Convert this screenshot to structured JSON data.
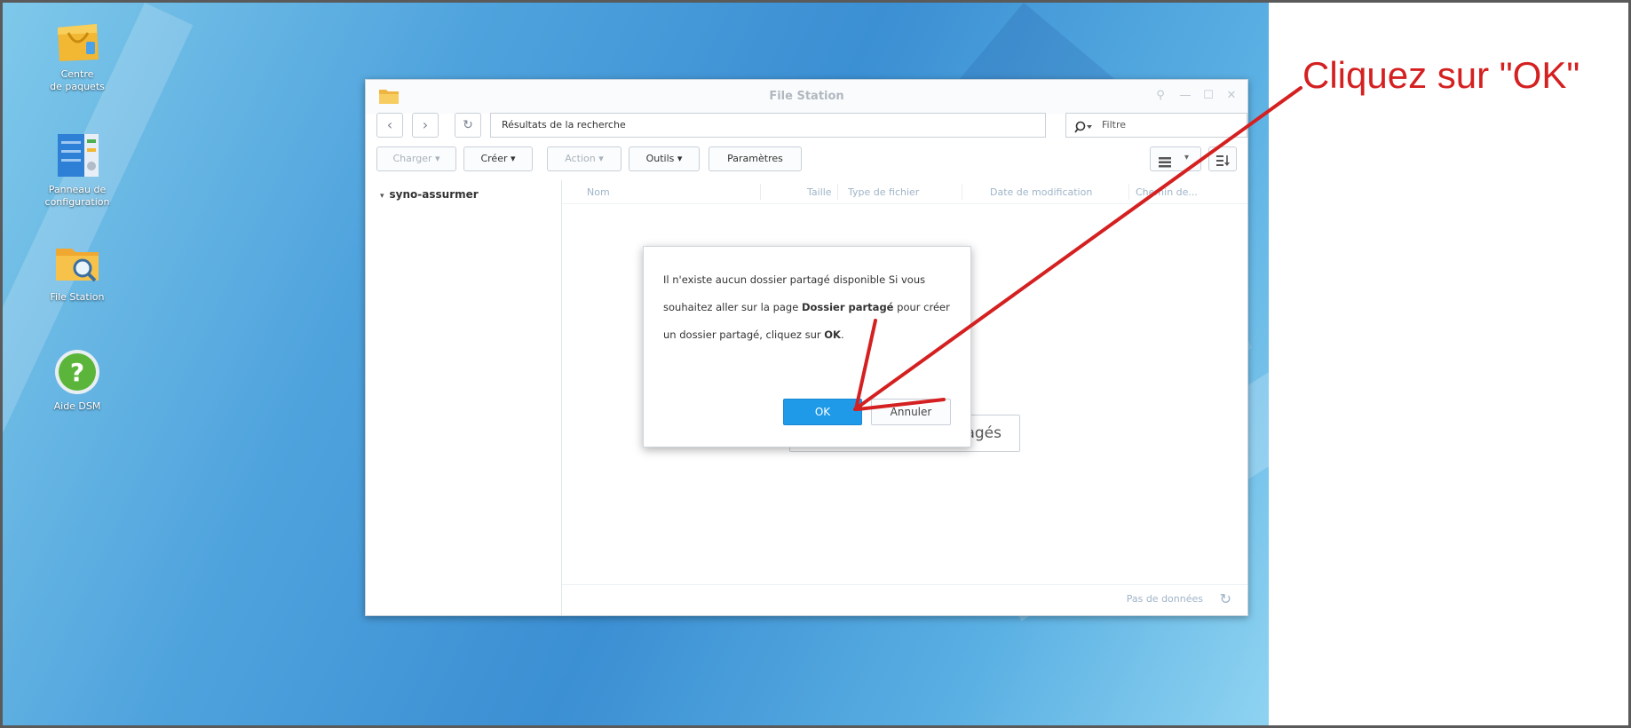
{
  "desktop": {
    "icons": [
      {
        "label_line1": "Centre",
        "label_line2": "de paquets",
        "icon": "package-center-icon"
      },
      {
        "label_line1": "Panneau de",
        "label_line2": "configuration",
        "icon": "control-panel-icon"
      },
      {
        "label_line1": "File Station",
        "label_line2": "",
        "icon": "file-station-icon"
      },
      {
        "label_line1": "Aide DSM",
        "label_line2": "",
        "icon": "help-icon"
      }
    ]
  },
  "window": {
    "title": "File Station",
    "path": "Résultats de la recherche",
    "filter_placeholder": "Filtre",
    "toolbar": {
      "charger": "Charger ▾",
      "creer": "Créer ▾",
      "action": "Action ▾",
      "outils": "Outils ▾",
      "parametres": "Paramètres"
    },
    "tree": {
      "root": "syno-assurmer"
    },
    "columns": [
      "Nom",
      "Taille",
      "Type de fichier",
      "Date de modification",
      "Chemin de..."
    ],
    "background_button_text": "agés",
    "footer": {
      "status": "Pas de données"
    }
  },
  "dialog": {
    "message_part1": "Il n'existe aucun dossier partagé disponible Si vous souhaitez aller sur la page ",
    "message_bold1": "Dossier partagé",
    "message_part2": " pour créer un dossier partagé, cliquez sur ",
    "message_bold2": "OK",
    "message_part3": ".",
    "ok": "OK",
    "cancel": "Annuler"
  },
  "annotation": {
    "text": "Cliquez sur \"OK\"",
    "color": "#d42020"
  },
  "colors": {
    "ok_button": "#1e9ae8",
    "column_header": "#9fb4c8"
  }
}
